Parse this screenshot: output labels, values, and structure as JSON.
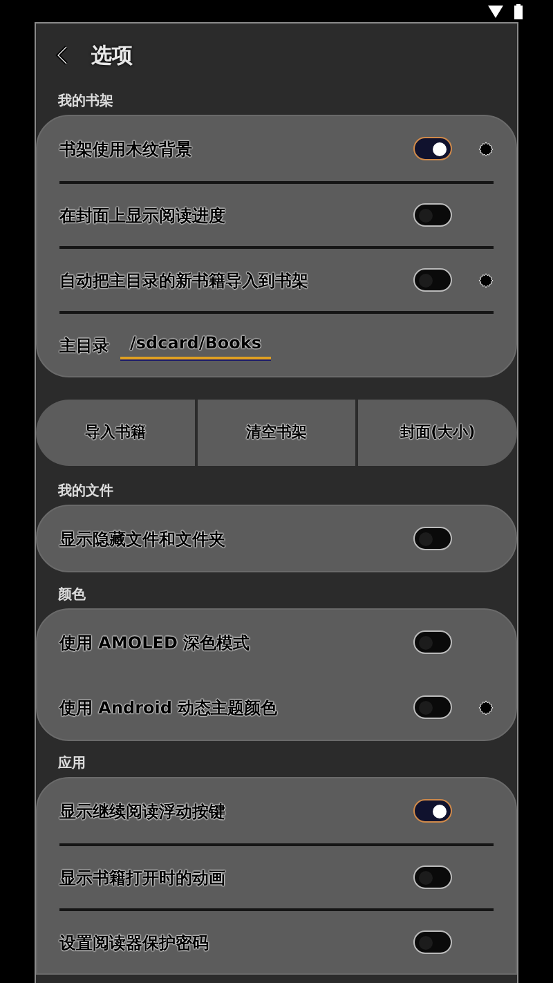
{
  "header": {
    "title": "选项"
  },
  "sections": [
    {
      "title": "我的书架",
      "rows": [
        {
          "kind": "toggle",
          "label": "书架使用木纹背景",
          "on": true,
          "settings": true
        },
        {
          "kind": "toggle",
          "label": "在封面上显示阅读进度",
          "on": false,
          "settings": false
        },
        {
          "kind": "toggle",
          "label": "自动把主目录的新书籍导入到书架",
          "on": false,
          "settings": true
        },
        {
          "kind": "path",
          "label": "主目录",
          "value": "/sdcard/Books"
        }
      ],
      "dividers": true,
      "buttons": [
        "导入书籍",
        "清空书架",
        "封面(大小)"
      ]
    },
    {
      "title": "我的文件",
      "rows": [
        {
          "kind": "toggle",
          "label": "显示隐藏文件和文件夹",
          "on": false,
          "settings": false
        }
      ]
    },
    {
      "title": "颜色",
      "rows": [
        {
          "kind": "toggle",
          "label": "使用 AMOLED 深色模式",
          "on": false,
          "settings": false
        },
        {
          "kind": "toggle",
          "label": "使用 Android 动态主题颜色",
          "on": false,
          "settings": true
        }
      ],
      "dividers": false
    },
    {
      "title": "应用",
      "rows": [
        {
          "kind": "toggle",
          "label": "显示继续阅读浮动按键",
          "on": true,
          "settings": false
        },
        {
          "kind": "toggle",
          "label": "显示书籍打开时的动画",
          "on": false,
          "settings": false
        },
        {
          "kind": "toggle",
          "label": "设置阅读器保护密码",
          "on": false,
          "settings": false
        }
      ],
      "dividers": true,
      "cut": true
    }
  ]
}
